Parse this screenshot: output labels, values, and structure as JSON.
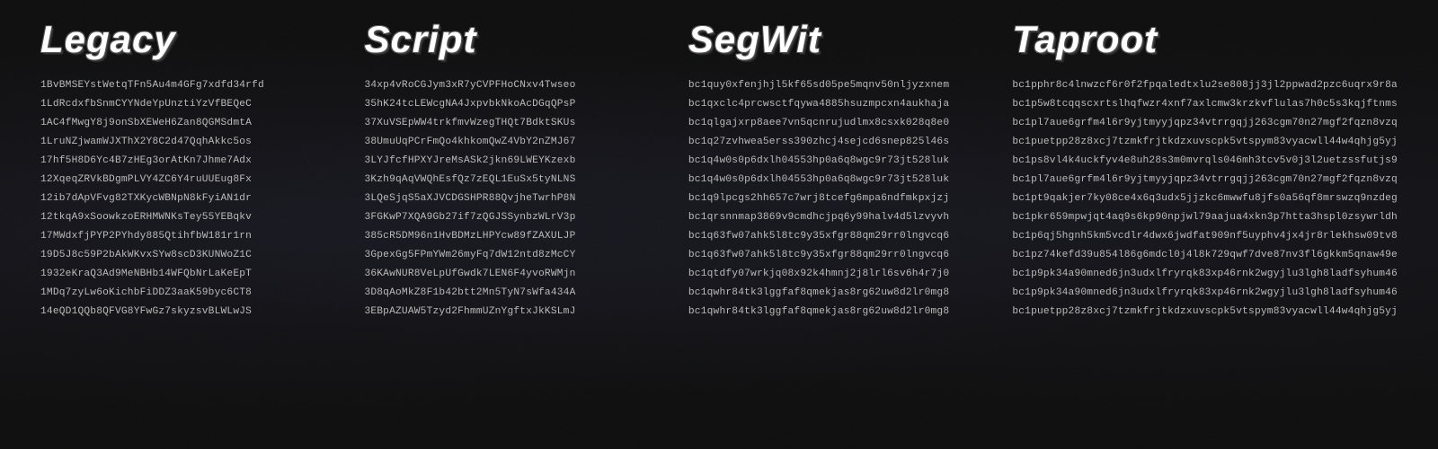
{
  "columns": [
    {
      "id": "legacy",
      "title": "Legacy",
      "addresses": [
        "1BvBMSEYstWetqTFn5Au4m4GFg7xdfd34rfd",
        "1LdRcdxfbSnmCYYNdeYpUnztiYzVfBEQeC",
        "1AC4fMwgY8j9onSbXEWeH6Zan8QGMSdmtA",
        "1LruNZjwamWJXThX2Y8C2d47QqhAkkc5os",
        "17hf5H8D6Yc4B7zHEg3orAtKn7Jhme7Adx",
        "12XqeqZRVkBDgmPLVY4ZC6Y4ruUUEug8Fx",
        "12ib7dApVFvg82TXKycWBNpN8kFyiAN1dr",
        "12tkqA9xSoowkzoERHMWNKsTey55YEBqkv",
        "17MWdxfjPYP2PYhdy885QtihfbW181r1rn",
        "19D5J8c59P2bAkWKvxSYw8scD3KUNWoZ1C",
        "1932eKraQ3Ad9MeNBHb14WFQbNrLaKeEpT",
        "1MDq7zyLw6oKichbFiDDZ3aaK59byc6CT8",
        "14eQD1QQb8QFVG8YFwGz7skyzsvBLWLwJS"
      ]
    },
    {
      "id": "script",
      "title": "Script",
      "addresses": [
        "34xp4vRoCGJym3xR7yCVPFHoCNxv4Twseo",
        "35hK24tcLEWcgNA4JxpvbkNkoAcDGqQPsP",
        "37XuVSEpWW4trkfmvWzegTHQt7BdktSKUs",
        "38UmuUqPCrFmQo4khkomQwZ4VbY2nZMJ67",
        "3LYJfcfHPXYJreMsASk2jkn69LWEYKzexb",
        "3Kzh9qAqVWQhEsfQz7zEQL1EuSx5tyNLNS",
        "3LQeSjqS5aXJVCDGSHPR88QvjheTwrhP8N",
        "3FGKwP7XQA9Gb27if7zQGJSSynbzWLrV3p",
        "385cR5DM96n1HvBDMzLHPYcw89fZAXULJP",
        "3GpexGg5FPmYWm26myFq7dW12ntd8zMcCY",
        "36KAwNUR8VeLpUfGwdk7LEN6F4yvoRWMjn",
        "3D8qAoMkZ8F1b42btt2Mn5TyN7sWfa434A",
        "3EBpAZUAW5Tzyd2FhmmUZnYgftxJkKSLmJ"
      ]
    },
    {
      "id": "segwit",
      "title": "SegWit",
      "addresses": [
        "bc1quy0xfenjhjl5kf65sd05pe5mqnv50nljyzxnem",
        "bc1qxclc4prcwsctfqywa4885hsuzmpcxn4aukhaja",
        "bc1qlgajxrp8aee7vn5qcnrujudlmx8csxk028q8e0",
        "bc1q27zvhwea5erss390zhcj4sejcd6snep825l46s",
        "bc1q4w0s0p6dxlh04553hp0a6q8wgc9r73jt528luk",
        "bc1q4w0s0p6dxlh04553hp0a6q8wgc9r73jt528luk",
        "bc1q9lpcgs2hh657c7wrj8tcefg6mpa6ndfmkpxjzj",
        "bc1qrsnnmap3869v9cmdhcjpq6y99halv4d5lzvyvh",
        "bc1q63fw07ahk5l8tc9y35xfgr88qm29rr0lngvcq6",
        "bc1q63fw07ahk5l8tc9y35xfgr88qm29rr0lngvcq6",
        "bc1qtdfy07wrkjq08x92k4hmnj2j8lrl6sv6h4r7j0",
        "bc1qwhr84tk3lggfaf8qmekjas8rg62uw8d2lr0mg8",
        "bc1qwhr84tk3lggfaf8qmekjas8rg62uw8d2lr0mg8"
      ]
    },
    {
      "id": "taproot",
      "title": "Taproot",
      "addresses": [
        "bc1pphr8c4lnwzcf6r0f2fpqaledtxlu2se808jj3jl2ppwad2pzc6uqrx9r8a",
        "bc1p5w8tcqqscxrtslhqfwzr4xnf7axlcmw3krzkvflulas7h0c5s3kqjftnms",
        "bc1pl7aue6grfm4l6r9yjtmyyjqpz34vtrrgqjj263cgm70n27mgf2fqzn8vzq",
        "bc1puetpp28z8xcj7tzmkfrjtkdzxuvscpk5vtspym83vyacwll44w4qhjg5yj",
        "bc1ps8vl4k4uckfyv4e8uh28s3m0mvrqls046mh3tcv5v0j3l2uetzssfutjs9",
        "bc1pl7aue6grfm4l6r9yjtmyyjqpz34vtrrgqjj263cgm70n27mgf2fqzn8vzq",
        "bc1pt9qakjer7ky08ce4x6q3udx5jjzkc6mwwfu8jfs0a56qf8mrswzq9nzdeg",
        "bc1pkr659mpwjqt4aq9s6kp90npjwl79aajua4xkn3p7htta3hspl0zsywrldh",
        "bc1p6qj5hgnh5km5vcdlr4dwx6jwdfat909nf5uyphv4jx4jr8rlekhsw09tv8",
        "bc1pz74kefd39u854l86g6mdcl0j4l8k729qwf7dve87nv3fl6gkkm5qnaw49e",
        "bc1p9pk34a90mned6jn3udxlfryrqk83xp46rnk2wgyjlu3lgh8ladfsyhum46",
        "bc1p9pk34a90mned6jn3udxlfryrqk83xp46rnk2wgyjlu3lgh8ladfsyhum46",
        "bc1puetpp28z8xcj7tzmkfrjtkdzxuvscpk5vtspym83vyacwll44w4qhjg5yj"
      ]
    }
  ]
}
